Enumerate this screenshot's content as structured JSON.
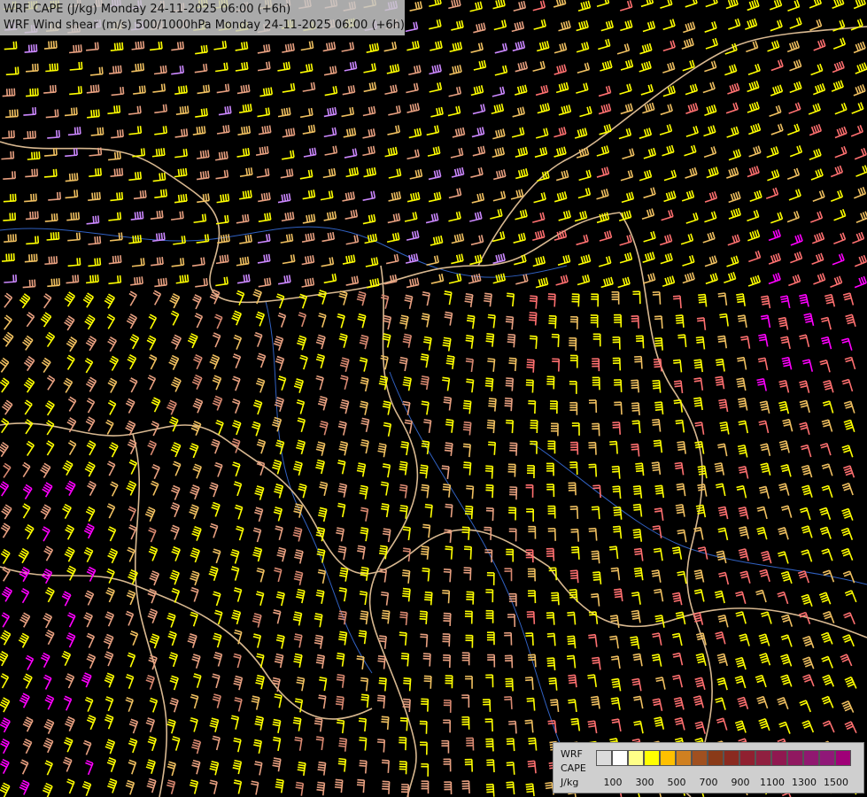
{
  "header": {
    "line1": "WRF CAPE (J/kg) Monday 24-11-2025 06:00 (+6h)",
    "line2": "WRF Wind shear (m/s) 500/1000hPa Monday 24-11-2025 06:00 (+6h)"
  },
  "legend": {
    "title_1": "WRF",
    "title_2": "CAPE",
    "unit": "J/kg",
    "ticks": [
      "100",
      "300",
      "500",
      "700",
      "900",
      "1100",
      "1300",
      "1500"
    ],
    "colors": [
      "#dcdcdc",
      "#ffffff",
      "#ffff88",
      "#ffff00",
      "#ffc000",
      "#d08020",
      "#a05020",
      "#8a3a18",
      "#8a2a20",
      "#902030",
      "#902040",
      "#901850",
      "#901860",
      "#901870",
      "#901878",
      "#a00078"
    ]
  },
  "map": {
    "background": "#000000",
    "barb_colors": [
      "#ffff00",
      "#e8a080",
      "#d88870",
      "#ff00ff",
      "#cc88ff",
      "#f0c060",
      "#ff7070"
    ],
    "border_color": "#d8b890",
    "river_color": "#3060c0"
  }
}
